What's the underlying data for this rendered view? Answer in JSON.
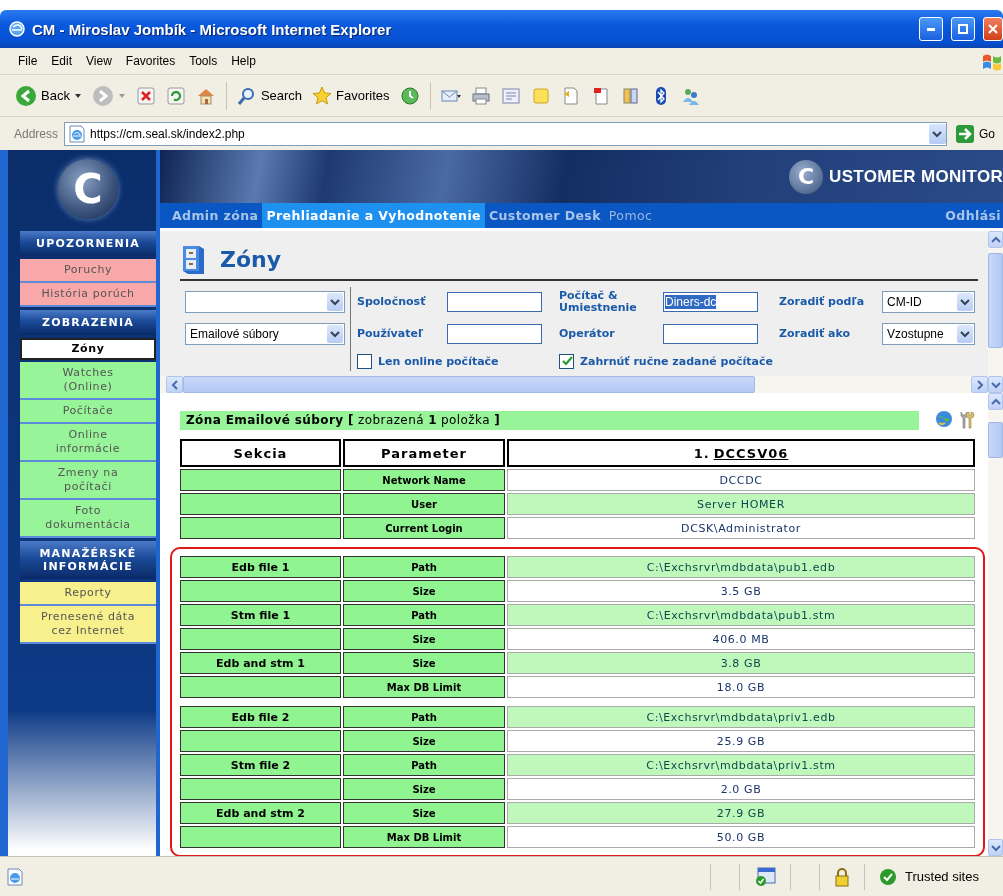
{
  "window": {
    "title": "CM - Miroslav Jombík - Microsoft Internet Explorer"
  },
  "menu": [
    "File",
    "Edit",
    "View",
    "Favorites",
    "Tools",
    "Help"
  ],
  "toolbar": {
    "back": "Back",
    "search": "Search",
    "favorites": "Favorites"
  },
  "address": {
    "label": "Address",
    "url": "https://cm.seal.sk/index2.php",
    "go": "Go"
  },
  "app": {
    "logo_letter": "C",
    "brand_letter": "C",
    "brand_text": "USTOMER MONITOR"
  },
  "nav": {
    "items": [
      {
        "label": "Admin zóna",
        "selected": false,
        "kind": "primary"
      },
      {
        "label": "Prehliadanie a Vyhodnotenie",
        "selected": true,
        "kind": "primary"
      },
      {
        "label": "Customer Desk",
        "selected": false,
        "kind": "primary"
      },
      {
        "label": "Pomoc",
        "selected": false,
        "kind": "secondary"
      }
    ],
    "logout": "Odhlási"
  },
  "sidebar": [
    {
      "title": "UPOZORNENIA",
      "color": "#f8a8a8",
      "items": [
        {
          "label": "Poruchy",
          "selected": false
        },
        {
          "label": "História porúch",
          "selected": false
        }
      ]
    },
    {
      "title": "ZOBRAZENIA",
      "color": "#98f498",
      "items": [
        {
          "label": "Zóny",
          "selected": true
        },
        {
          "label": "Watches (Online)",
          "selected": false
        },
        {
          "label": "Počítače",
          "selected": false
        },
        {
          "label": "Online informácie",
          "selected": false
        },
        {
          "label": "Zmeny na počítači",
          "selected": false
        },
        {
          "label": "Foto dokumentácia",
          "selected": false
        }
      ]
    },
    {
      "title": "MANAŽÉRSKÉ INFORMÁCIE",
      "color": "#f8f08c",
      "items": [
        {
          "label": "Reporty",
          "selected": false
        },
        {
          "label": "Prenesené dáta cez Internet",
          "selected": false
        }
      ]
    }
  ],
  "filter": {
    "title": "Zóny",
    "selects": [
      {
        "kind": "blank"
      },
      {
        "kind": "filled",
        "value": "Emailové súbory"
      }
    ],
    "fields": [
      {
        "label": "Spoločnosť"
      },
      {
        "label": "Používateľ"
      },
      {
        "label": "Počítač & Umiestnenie",
        "value": "Diners-dc",
        "highlighted": true
      },
      {
        "label": "Operátor"
      }
    ],
    "sort": [
      {
        "label": "Zoradiť podľa",
        "value": "CM-ID"
      },
      {
        "label": "Zoradiť ako",
        "value": "Vzostupne"
      }
    ],
    "checkboxes": [
      {
        "label": "Len online počítače",
        "checked": false
      },
      {
        "label": "Zahrnúť ručne zadané počítače",
        "checked": true
      }
    ]
  },
  "results": {
    "heading": "**Zóna Emailové súbory [** zobrazená **1** položka **]**",
    "columns": [
      {
        "label": "Sekcia"
      },
      {
        "label": "Parameter"
      },
      {
        "number": "1.",
        "link": "DCCSV06"
      }
    ],
    "groups": [
      {
        "outlined": false,
        "blocks": [
          [
            {
              "parameter": "Network Name",
              "value": "DCCDC",
              "shaded": false
            },
            {
              "parameter": "User",
              "value": "Server HOMER",
              "shaded": true
            },
            {
              "parameter": "Current Login",
              "value": "DCSK\\Administrator",
              "shaded": false
            }
          ]
        ]
      },
      {
        "outlined": true,
        "blocks": [
          [
            {
              "section": "Edb file 1",
              "parameter": "Path",
              "value": "C:\\Exchsrvr\\mdbdata\\pub1.edb",
              "shaded": true
            },
            {
              "parameter": "Size",
              "value": "3.5 GB",
              "shaded": false
            },
            {
              "section": "Stm file 1",
              "parameter": "Path",
              "value": "C:\\Exchsrvr\\mdbdata\\pub1.stm",
              "shaded": true
            },
            {
              "parameter": "Size",
              "value": "406.0 MB",
              "shaded": false
            },
            {
              "section": "Edb and stm 1",
              "parameter": "Size",
              "value": "3.8 GB",
              "shaded": true
            },
            {
              "parameter": "Max DB Limit",
              "value": "18.0 GB",
              "shaded": false
            }
          ],
          [
            {
              "section": "Edb file 2",
              "parameter": "Path",
              "value": "C:\\Exchsrvr\\mdbdata\\priv1.edb",
              "shaded": true
            },
            {
              "parameter": "Size",
              "value": "25.9 GB",
              "shaded": false
            },
            {
              "section": "Stm file 2",
              "parameter": "Path",
              "value": "C:\\Exchsrvr\\mdbdata\\priv1.stm",
              "shaded": true
            },
            {
              "parameter": "Size",
              "value": "2.0 GB",
              "shaded": false
            },
            {
              "section": "Edb and stm 2",
              "parameter": "Size",
              "value": "27.9 GB",
              "shaded": true
            },
            {
              "parameter": "Max DB Limit",
              "value": "50.0 GB",
              "shaded": false
            }
          ]
        ]
      }
    ]
  },
  "status_bar": {
    "zone": "Trusted sites"
  }
}
